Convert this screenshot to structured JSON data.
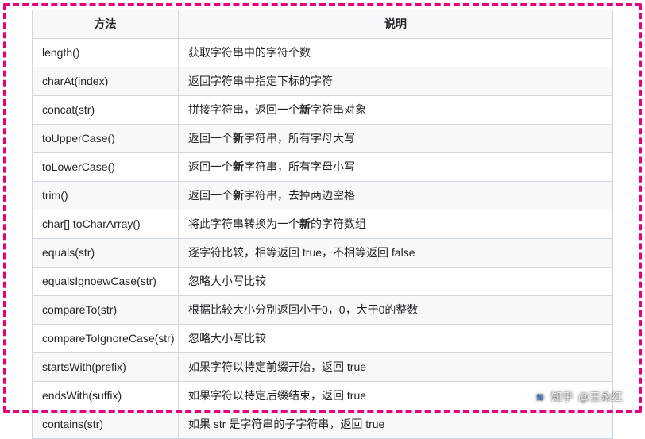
{
  "table": {
    "headers": {
      "method": "方法",
      "desc": "说明"
    },
    "rows": [
      {
        "method": "length()",
        "desc": "获取字符串中的字符个数"
      },
      {
        "method": "charAt(index)",
        "desc": "返回字符串中指定下标的字符"
      },
      {
        "method": "concat(str)",
        "desc_pre": "拼接字符串，返回一个",
        "desc_bold": "新",
        "desc_post": "字符串对象"
      },
      {
        "method": "toUpperCase()",
        "desc_pre": "返回一个",
        "desc_bold": "新",
        "desc_post": "字符串，所有字母大写"
      },
      {
        "method": "toLowerCase()",
        "desc_pre": "返回一个",
        "desc_bold": "新",
        "desc_post": "字符串，所有字母小写"
      },
      {
        "method": "trim()",
        "desc_pre": "返回一个",
        "desc_bold": "新",
        "desc_post": "字符串，去掉两边空格"
      },
      {
        "method": "char[] toCharArray()",
        "desc_pre": "将此字符串转换为一个",
        "desc_bold": "新",
        "desc_post": "的字符数组"
      },
      {
        "method": "equals(str)",
        "desc": "逐字符比较，相等返回 true，不相等返回 false"
      },
      {
        "method": "equalsIgnoewCase(str)",
        "desc": "忽略大小写比较"
      },
      {
        "method": "compareTo(str)",
        "desc": "根据比较大小分别返回小于0，0，大于0的整数"
      },
      {
        "method": "compareToIgnoreCase(str)",
        "desc": "忽略大小写比较"
      },
      {
        "method": "startsWith(prefix)",
        "desc": "如果字符以特定前缀开始，返回 true"
      },
      {
        "method": "endsWith(suffix)",
        "desc": "如果字符以特定后缀结束，返回 true"
      },
      {
        "method": "contains(str)",
        "desc": "如果 str 是字符串的子字符串，返回 true"
      }
    ]
  },
  "watermark": {
    "brand": "知乎",
    "author": "@王永红"
  }
}
